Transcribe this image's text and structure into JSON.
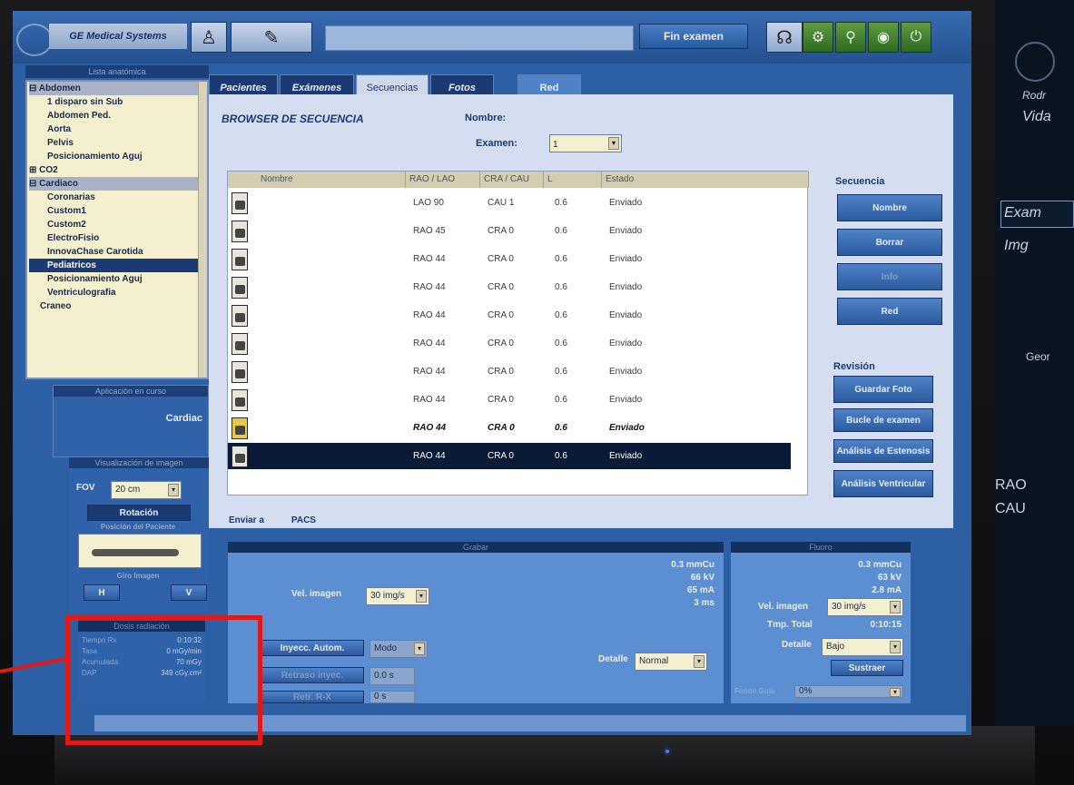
{
  "header": {
    "brand_label": "GE Medical Systems",
    "fin_examen_label": "Fin examen"
  },
  "tabs": [
    {
      "label": "Pacientes"
    },
    {
      "label": "Exámenes"
    },
    {
      "label": "Secuencias"
    },
    {
      "label": "Fotos"
    },
    {
      "label": "Red"
    }
  ],
  "sidebar": {
    "anatomy_title": "Lista anatómica",
    "anatomy_items": [
      {
        "label": "⊟ Abdomen"
      },
      {
        "label": "1 disparo sin Sub"
      },
      {
        "label": "Abdomen Ped."
      },
      {
        "label": "Aorta"
      },
      {
        "label": "Pelvis"
      },
      {
        "label": "Posicionamiento Aguj"
      },
      {
        "label": "⊞ CO2"
      },
      {
        "label": "⊟ Cardiaco"
      },
      {
        "label": "Coronarias"
      },
      {
        "label": "Custom1"
      },
      {
        "label": "Custom2"
      },
      {
        "label": "ElectroFisio"
      },
      {
        "label": "InnovaChase Carotida"
      },
      {
        "label": "Pediatricos"
      },
      {
        "label": "Posicionamiento Aguj"
      },
      {
        "label": "Ventriculografia"
      },
      {
        "label": "Craneo"
      }
    ],
    "app_title": "Aplicación en curso",
    "app_value": "Cardiac",
    "vis_title": "Visualización de imagen",
    "fov_label": "FOV",
    "fov_value": "20 cm",
    "rotacion_label": "Rotación",
    "posicion_label": "Posición del Paciente",
    "giro_label": "Giro Imagen",
    "giro_h": "H",
    "giro_v": "V"
  },
  "dose": {
    "title": "Dosis radiación",
    "rows": [
      {
        "label": "Tiempo Rx",
        "value": "0:10:32"
      },
      {
        "label": "Tasa",
        "value": "0 mGy/min"
      },
      {
        "label": "Acumulada",
        "value": "70 mGy"
      },
      {
        "label": "DAP",
        "value": "349 cGy.cm²"
      }
    ]
  },
  "browser": {
    "title": "BROWSER DE SECUENCIA",
    "nombre_label": "Nombre:",
    "examen_label": "Examen:",
    "examen_value": "1",
    "columns": [
      "Nombre",
      "RAO / LAO",
      "CRA / CAU",
      "L",
      "Estado"
    ],
    "rows": [
      {
        "rao": "LAO 90",
        "cra": "CAU 1",
        "l": "0.6",
        "estado": "Enviado"
      },
      {
        "rao": "RAO 45",
        "cra": "CRA 0",
        "l": "0.6",
        "estado": "Enviado"
      },
      {
        "rao": "RAO 44",
        "cra": "CRA 0",
        "l": "0.6",
        "estado": "Enviado"
      },
      {
        "rao": "RAO 44",
        "cra": "CRA 0",
        "l": "0.6",
        "estado": "Enviado"
      },
      {
        "rao": "RAO 44",
        "cra": "CRA 0",
        "l": "0.6",
        "estado": "Enviado"
      },
      {
        "rao": "RAO 44",
        "cra": "CRA 0",
        "l": "0.6",
        "estado": "Enviado"
      },
      {
        "rao": "RAO 44",
        "cra": "CRA 0",
        "l": "0.6",
        "estado": "Enviado"
      },
      {
        "rao": "RAO 44",
        "cra": "CRA 0",
        "l": "0.6",
        "estado": "Enviado"
      },
      {
        "rao": "RAO 44",
        "cra": "CRA 0",
        "l": "0.6",
        "estado": "Enviado"
      },
      {
        "rao": "RAO 44",
        "cra": "CRA 0",
        "l": "0.6",
        "estado": "Enviado"
      }
    ],
    "enviar_label": "Enviar a",
    "enviar_value": "PACS",
    "secuencia_title": "Secuencia",
    "secuencia_buttons": [
      "Nombre",
      "Borrar",
      "Info",
      "Red"
    ],
    "revision_title": "Revisión",
    "revision_buttons": [
      "Guardar Foto",
      "Bucle de examen",
      "Análisis de Estenosis",
      "Análisis Ventricular"
    ]
  },
  "grabar": {
    "title": "Grabar",
    "vel_label": "Vel. imagen",
    "vel_value": "30 img/s",
    "params": [
      "0.3 mmCu",
      "66 kV",
      "65 mA",
      "3 ms"
    ],
    "inyecc_label": "Inyecc. Autom.",
    "inyecc_value": "Modo",
    "retraso_label": "Retraso inyec.",
    "retraso_value": "0.0 s",
    "retr_label": "Retr. R-X",
    "retr_value": "0 s",
    "detalle_label": "Detalle",
    "detalle_value": "Normal"
  },
  "fluoro": {
    "title": "Fluoro",
    "params": [
      "0.3 mmCu",
      "63 kV",
      "2.8 mA"
    ],
    "vel_label": "Vel. imagen",
    "vel_value": "30 img/s",
    "tmp_label": "Tmp. Total",
    "tmp_value": "0:10:15",
    "detalle_label": "Detalle",
    "detalle_value": "Bajo",
    "sustraer_label": "Sustraer",
    "fondo_label": "Fondo Guía",
    "fondo_value": "0%"
  },
  "side_monitor": {
    "texts": [
      "Rodr",
      "Vida",
      "Exam",
      "Img",
      "Geor",
      "RAO",
      "CAU"
    ]
  }
}
